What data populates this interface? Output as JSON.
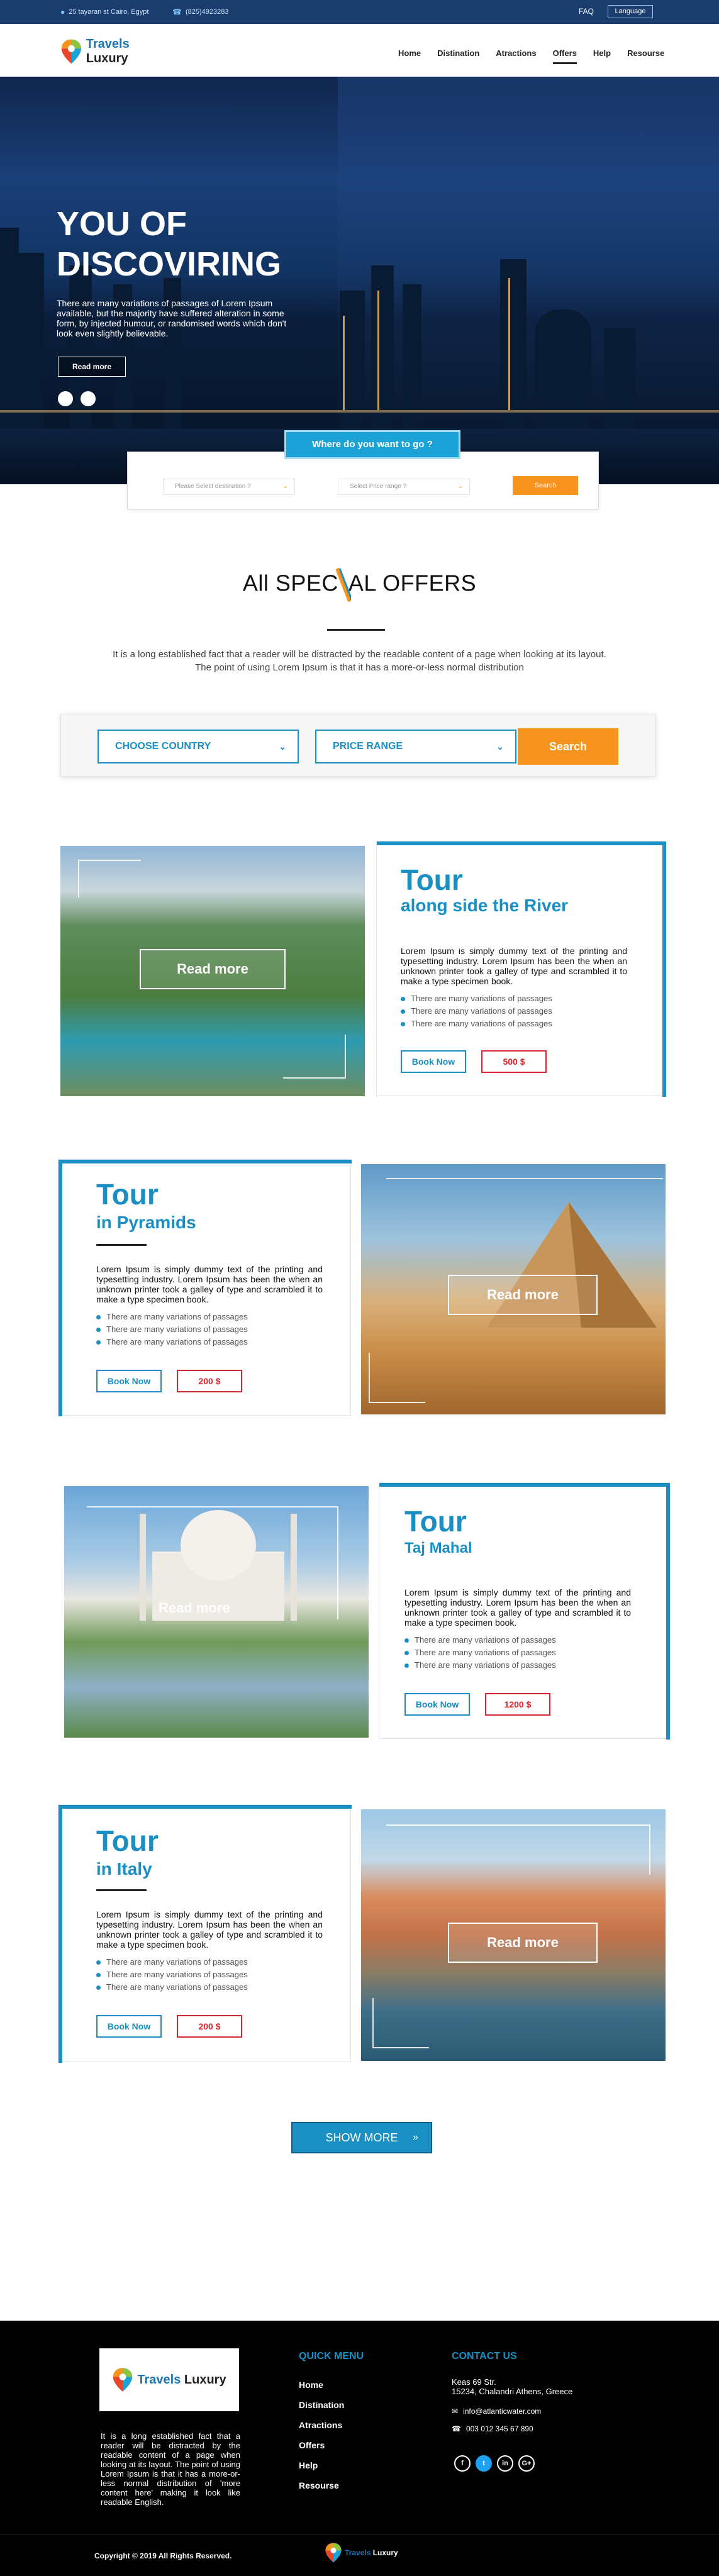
{
  "topbar": {
    "address": "25 tayaran st Cairo, Egypt",
    "phone": "(825)4923283",
    "faq": "FAQ",
    "language": "Language"
  },
  "brand": {
    "name_part1": "Travels",
    "name_part2": "Luxury"
  },
  "nav": {
    "items": [
      {
        "label": "Home"
      },
      {
        "label": "Distination"
      },
      {
        "label": "Atractions"
      },
      {
        "label": "Offers",
        "active": true
      },
      {
        "label": "Help"
      },
      {
        "label": "Resourse"
      }
    ]
  },
  "hero": {
    "title_line1": "YOU OF",
    "title_line2": "DISCOVIRING",
    "text": "There are many variations of passages of Lorem Ipsum available, but the majority have suffered alteration in some form, by injected humour, or randomised words which don't look even slightly believable.",
    "read_more": "Read more"
  },
  "mini_search": {
    "where_label": "Where do you want to go ?",
    "destination_placeholder": "Please Select destination ?",
    "price_placeholder": "Select Price range ?",
    "search_label": "Search"
  },
  "offers": {
    "title_part1": "All SPEC",
    "title_part2": "AL OFFERS",
    "desc_line1": "It is a long established fact that a reader will be distracted by the readable content of a page when looking at its layout.",
    "desc_line2": "The point of using Lorem Ipsum is that it has a more-or-less normal distribution"
  },
  "filter": {
    "country": "CHOOSE COUNTRY",
    "price": "PRICE RANGE",
    "search": "Search"
  },
  "tours": [
    {
      "title": "Tour",
      "subtitle": "along side the River",
      "desc": "Lorem Ipsum is simply dummy text of the printing and typesetting industry. Lorem Ipsum has been the when an unknown printer took a galley of type and scrambled it to make a type specimen book.",
      "bullets": [
        "There are many variations of passages",
        "There are many variations of passages",
        "There are many variations of passages"
      ],
      "book": "Book Now",
      "price": "500 $",
      "read_more": "Read more"
    },
    {
      "title": "Tour",
      "subtitle": "in Pyramids",
      "desc": "Lorem Ipsum is simply dummy text of the printing and typesetting industry. Lorem Ipsum has been the when an unknown printer took a galley of type and scrambled it to make a type specimen book.",
      "bullets": [
        "There are many variations of passages",
        "There are many variations of passages",
        "There are many variations of passages"
      ],
      "book": "Book Now",
      "price": "200 $",
      "read_more": "Read more"
    },
    {
      "title": "Tour",
      "subtitle": "Taj Mahal",
      "desc": "Lorem Ipsum is simply dummy text of the printing and typesetting industry. Lorem Ipsum has been the when an unknown printer took a galley of type and scrambled it to make a type specimen book.",
      "bullets": [
        "There are many variations of passages",
        "There are many variations of passages",
        "There are many variations of passages"
      ],
      "book": "Book Now",
      "price": "1200 $",
      "read_more": "Read more"
    },
    {
      "title": "Tour",
      "subtitle": "in Italy",
      "desc": "Lorem Ipsum is simply dummy text of the printing and typesetting industry. Lorem Ipsum has been the when an unknown printer took a galley of type and scrambled it to make a type specimen book.",
      "bullets": [
        "There are many variations of passages",
        "There are many variations of passages",
        "There are many variations of passages"
      ],
      "book": "Book Now",
      "price": "200 $",
      "read_more": "Read more"
    }
  ],
  "show_more": "SHOW MORE",
  "footer": {
    "about": "It is a long established fact that a reader will be distracted by the readable content of a page when looking at its layout. The point of using Lorem Ipsum is that it has a more-or-less normal distribution of 'more content here' making it look like readable English.",
    "quick_menu_title": "QUICK MENU",
    "quick_menu": [
      "Home",
      "Distination",
      "Atractions",
      "Offers",
      "Help",
      "Resourse"
    ],
    "contact_title": "CONTACT US",
    "address_line1": "Keas 69 Str.",
    "address_line2": "15234, Chalandri Athens, Greece",
    "email": "info@atlanticwater.com",
    "phone": "003 012 345 67 890",
    "social": [
      "f",
      "t",
      "in",
      "G+"
    ],
    "copyright": "Copyright © 2019 All Rights Reserved."
  },
  "colors": {
    "accent": "#1a8fc4",
    "orange": "#f7941d",
    "price_red": "#d8262e",
    "topbar": "#1a3d6e"
  }
}
